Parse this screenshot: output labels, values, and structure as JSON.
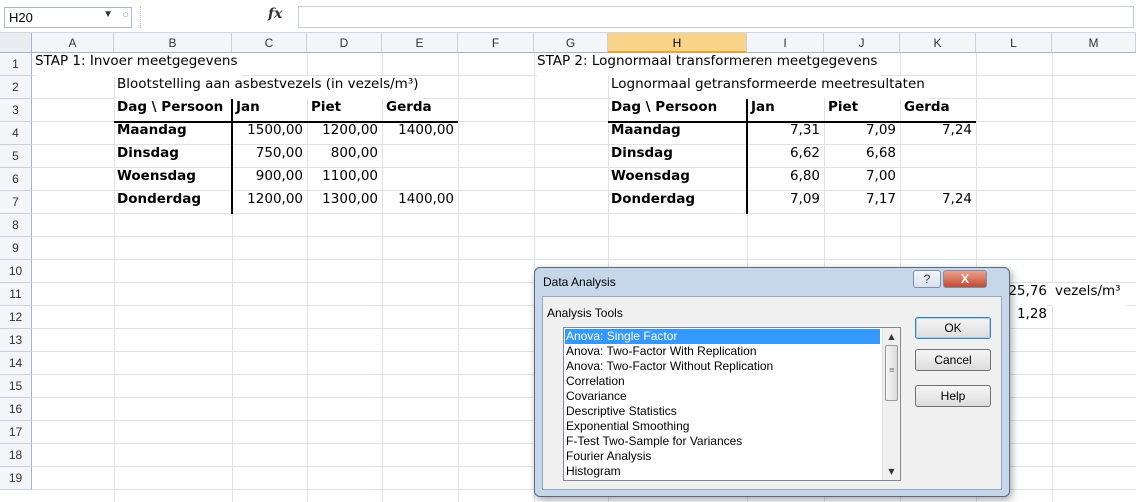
{
  "formula_bar": {
    "cell_ref": "H20",
    "fx_symbol": "fx",
    "formula": ""
  },
  "columns": [
    "A",
    "B",
    "C",
    "D",
    "E",
    "F",
    "G",
    "H",
    "I",
    "J",
    "K",
    "L",
    "M"
  ],
  "selected_column": "H",
  "rows": [
    "1",
    "2",
    "3",
    "4",
    "5",
    "6",
    "7",
    "8",
    "9",
    "10",
    "11",
    "12",
    "13",
    "14",
    "15",
    "16",
    "17",
    "18",
    "19"
  ],
  "sheet": {
    "step1_title": "STAP 1: Invoer meetgegevens",
    "step1_subtitle": "Blootstelling aan asbestvezels (in vezels/m³)",
    "step2_title": "STAP 2: Lognormaal transformeren meetgegevens",
    "step2_subtitle": "Lognormaal getransformeerde meetresultaten",
    "table1": {
      "header": [
        "Dag \\ Persoon",
        "Jan",
        "Piet",
        "Gerda"
      ],
      "rows": [
        [
          "Maandag",
          "1500,00",
          "1200,00",
          "1400,00"
        ],
        [
          "Dinsdag",
          "750,00",
          "800,00",
          ""
        ],
        [
          "Woensdag",
          "900,00",
          "1100,00",
          ""
        ],
        [
          "Donderdag",
          "1200,00",
          "1300,00",
          "1400,00"
        ]
      ]
    },
    "table2": {
      "header": [
        "Dag \\ Persoon",
        "Jan",
        "Piet",
        "Gerda"
      ],
      "rows": [
        [
          "Maandag",
          "7,31",
          "7,09",
          "7,24"
        ],
        [
          "Dinsdag",
          "6,62",
          "6,68",
          ""
        ],
        [
          "Woensdag",
          "6,80",
          "7,00",
          ""
        ],
        [
          "Donderdag",
          "7,09",
          "7,17",
          "7,24"
        ]
      ]
    },
    "l11": "25,76",
    "m11": "vezels/m³",
    "l12": "1,28"
  },
  "dialog": {
    "title": "Data Analysis",
    "help_glyph": "?",
    "close_glyph": "X",
    "label": "Analysis Tools",
    "selected_index": 0,
    "tools": [
      "Anova: Single Factor",
      "Anova: Two-Factor With Replication",
      "Anova: Two-Factor Without Replication",
      "Correlation",
      "Covariance",
      "Descriptive Statistics",
      "Exponential Smoothing",
      "F-Test Two-Sample for Variances",
      "Fourier Analysis",
      "Histogram"
    ],
    "ok_label": "OK",
    "cancel_label": "Cancel",
    "help_label": "Help"
  }
}
